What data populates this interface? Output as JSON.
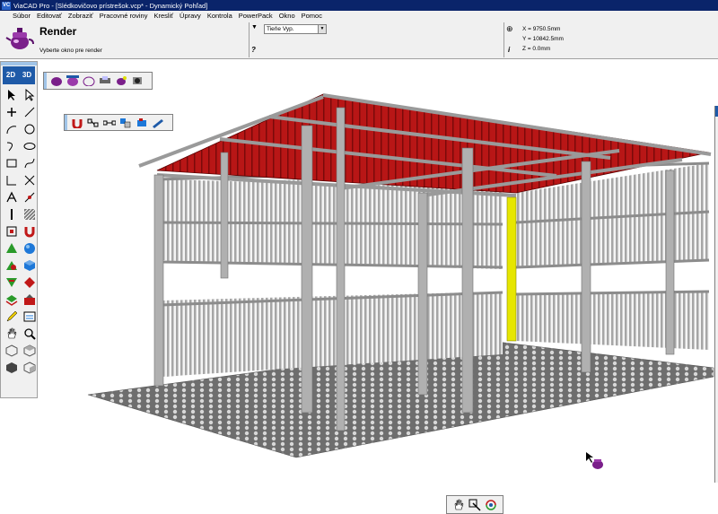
{
  "app": {
    "logo": "VC",
    "title": "ViaCAD Pro - [Slédkovičovo prístrešok.vcp* - Dynamický Pohľad]"
  },
  "menu": [
    "Súbor",
    "Editovať",
    "Zobraziť",
    "Pracovné roviny",
    "Kresliť",
    "Úpravy",
    "Kontrola",
    "PowerPack",
    "Okno",
    "Pomoc"
  ],
  "panel": {
    "title": "Render",
    "prompt": "Vyberte okno pre render",
    "dropdown_value": "Tieňe Vyp.",
    "help": "?",
    "info": "i",
    "coords": {
      "x": "X = 9750.5mm",
      "y": "Y = 10842.5mm",
      "z": "Z = 0.0mm"
    }
  },
  "lefttoolbar": {
    "mode_2d": "2D",
    "mode_3d": "3D"
  },
  "colors": {
    "roof": "#b81616",
    "frame": "#a8a8a8",
    "highlight": "#e6e600",
    "floor": "#7a7a7a",
    "accent": "#1e5aa8"
  },
  "icons": {
    "left_tools": [
      "select-arrow-icon",
      "select-point-icon",
      "point-icon",
      "line-icon",
      "arc-icon",
      "circle-icon",
      "curve-icon",
      "ellipse-icon",
      "rectangle-icon",
      "spline-icon",
      "corner-icon",
      "trim-icon",
      "text-icon",
      "dimension-icon",
      "vertical-line-icon",
      "hatch-icon",
      "transform-icon",
      "magnet-icon",
      "pyramid-icon",
      "sphere-icon",
      "boolean-icon",
      "cube-icon",
      "bend-icon",
      "shell-icon",
      "layer-icon",
      "explode-icon",
      "pencil-icon",
      "measure-icon",
      "pan-hand-icon",
      "zoom-icon",
      "view-iso-icon",
      "view-top-icon",
      "view-front-icon",
      "view-right-icon",
      "render-icon",
      "render-options-icon"
    ]
  }
}
